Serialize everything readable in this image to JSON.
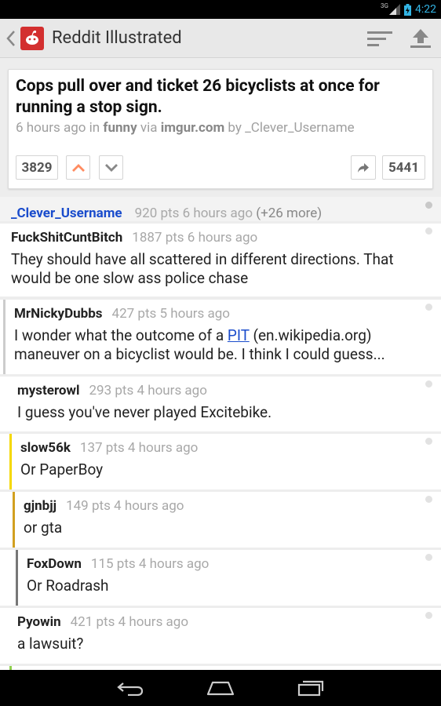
{
  "status_bar": {
    "network": "3G",
    "time": "4:22"
  },
  "app": {
    "title": "Reddit Illustrated"
  },
  "post": {
    "title": "Cops pull over and ticket 26 bicyclists at once for running a stop sign.",
    "age": "6 hours ago in",
    "subreddit": "funny",
    "via": "via",
    "domain": "imgur.com",
    "by": "by _Clever_Username",
    "score": "3829",
    "comment_count": "5441"
  },
  "op_comment": {
    "author": "_Clever_Username",
    "meta": "920 pts 6 hours ago",
    "more": "(+26 more)",
    "author_color": "#1a4ccc"
  },
  "comments": [
    {
      "author": "FuckShitCuntBitch",
      "meta": "1887 pts 6 hours ago",
      "body": "They should have all scattered in different directions. That would be one slow ass police chase",
      "stripe_color": ""
    },
    {
      "author": "MrNickyDubbs",
      "meta": "427 pts 5 hours ago",
      "body_before": "I wonder what the outcome of a ",
      "link_text": "PIT",
      "body_after": " (en.wikipedia.org) maneuver on a bicyclist would be. I think I could guess...",
      "stripe_color": "#cccccc"
    },
    {
      "author": "mysterowl",
      "meta": "293 pts 4 hours ago",
      "body": "I guess you've never played Excitebike.",
      "stripe_color": "#ffffff"
    },
    {
      "author": "slow56k",
      "meta": "137 pts 4 hours ago",
      "body": "Or PaperBoy",
      "stripe_color": "#f5d800"
    },
    {
      "author": "gjnbjj",
      "meta": "149 pts 4 hours ago",
      "body": "or gta",
      "stripe_color": "#d2a020"
    },
    {
      "author": "FoxDown",
      "meta": "115 pts 4 hours ago",
      "body": "Or Roadrash",
      "stripe_color": "#777777"
    },
    {
      "author": "Pyowin",
      "meta": "421 pts 4 hours ago",
      "body": "a lawsuit?",
      "stripe_color": ""
    }
  ],
  "colors": {
    "accent": "#33b5e5",
    "upvote": "#ff8b60",
    "link": "#1a4ccc",
    "next_comment_stripe": "#8fd14f"
  }
}
